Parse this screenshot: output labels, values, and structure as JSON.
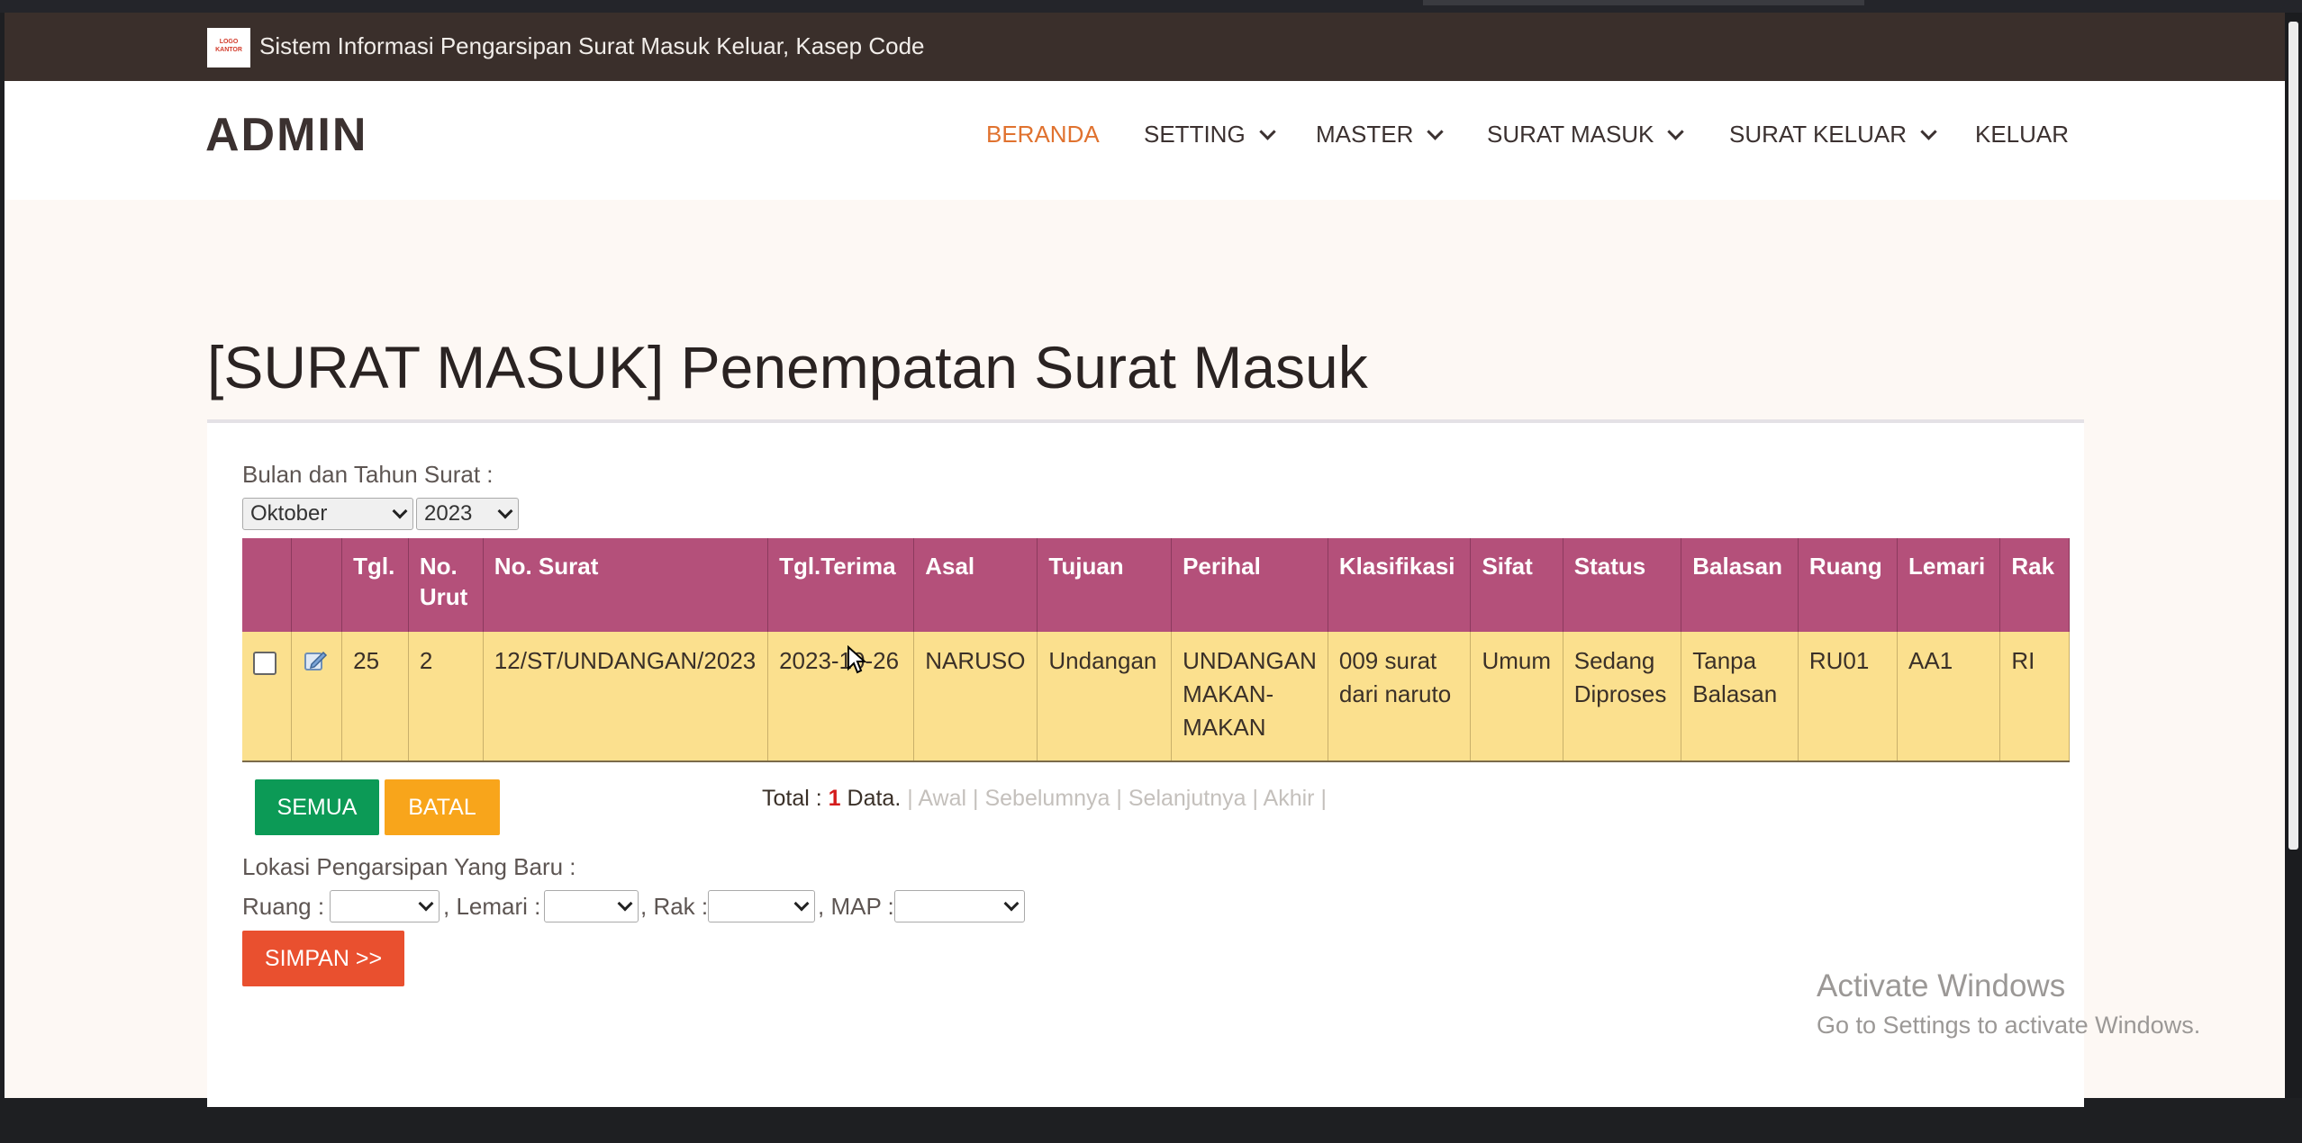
{
  "topbar": {
    "logo_text": "LOGO KANTOR",
    "site_title": "Sistem Informasi Pengarsipan Surat Masuk Keluar, Kasep Code"
  },
  "navbar": {
    "brand": "ADMIN",
    "items": [
      {
        "label": "BERANDA",
        "active": true,
        "dropdown": false
      },
      {
        "label": "SETTING",
        "active": false,
        "dropdown": true
      },
      {
        "label": "MASTER",
        "active": false,
        "dropdown": true
      },
      {
        "label": "SURAT MASUK",
        "active": false,
        "dropdown": true
      },
      {
        "label": "SURAT KELUAR",
        "active": false,
        "dropdown": true
      },
      {
        "label": "KELUAR",
        "active": false,
        "dropdown": false
      }
    ]
  },
  "page": {
    "title": "[SURAT MASUK] Penempatan Surat Masuk"
  },
  "filter": {
    "label": "Bulan dan Tahun Surat :",
    "month": "Oktober",
    "year": "2023"
  },
  "table": {
    "headers": [
      "",
      "",
      "Tgl.",
      "No. Urut",
      "No. Surat",
      "Tgl.Terima",
      "Asal",
      "Tujuan",
      "Perihal",
      "Klasifikasi",
      "Sifat",
      "Status",
      "Balasan",
      "Ruang",
      "Lemari",
      "Rak"
    ],
    "rows": [
      {
        "tgl": "25",
        "no_urut": "2",
        "no_surat": "12/ST/UNDANGAN/2023",
        "tgl_terima": "2023-10-26",
        "asal": "NARUSO",
        "tujuan": "Undangan",
        "perihal": "UNDANGAN MAKAN-MAKAN",
        "klasifikasi": "009 surat dari naruto",
        "sifat": "Umum",
        "status": "Sedang Diproses",
        "balasan": "Tanpa Balasan",
        "ruang": "RU01",
        "lemari": "AA1",
        "rak": "RI"
      }
    ]
  },
  "buttons": {
    "semua": "SEMUA",
    "batal": "BATAL",
    "simpan": "SIMPAN >>"
  },
  "pager": {
    "total_prefix": "Total :",
    "count": "1",
    "data_suffix": "Data.",
    "sep": "|",
    "first": "Awal",
    "prev": "Sebelumnya",
    "next": "Selanjutnya",
    "last": "Akhir"
  },
  "location": {
    "label": "Lokasi Pengarsipan Yang Baru :",
    "ruang_label": "Ruang :",
    "lemari_label": ", Lemari :",
    "rak_label": ", Rak :",
    "map_label": ", MAP :"
  },
  "watermark": {
    "line1": "Activate Windows",
    "line2": "Go to Settings to activate Windows."
  },
  "colors": {
    "header_bg": "#b4507a",
    "row_bg": "#fbe08e",
    "active_nav": "#e0722f",
    "topbar_bg": "#3a2f2b"
  }
}
